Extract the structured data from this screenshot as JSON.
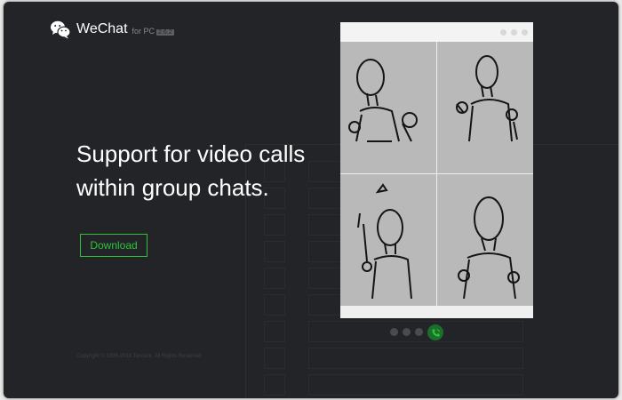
{
  "app": {
    "brand": "WeChat",
    "platform": "for PC",
    "version": "2.6.2"
  },
  "hero": {
    "line1": "Support for video calls",
    "line2": "within group chats."
  },
  "download_label": "Download",
  "copyright": "Copyright © 1998-2018 Tencent. All Rights Reserved",
  "carousel": {
    "slides": 4,
    "active_slide": 4,
    "active_icon": "phone-call-icon"
  },
  "preview": {
    "participants": [
      "participant-1",
      "participant-2",
      "participant-3",
      "participant-4"
    ]
  },
  "colors": {
    "background": "#232428",
    "accent": "#2ec43a",
    "text": "#ffffff"
  }
}
